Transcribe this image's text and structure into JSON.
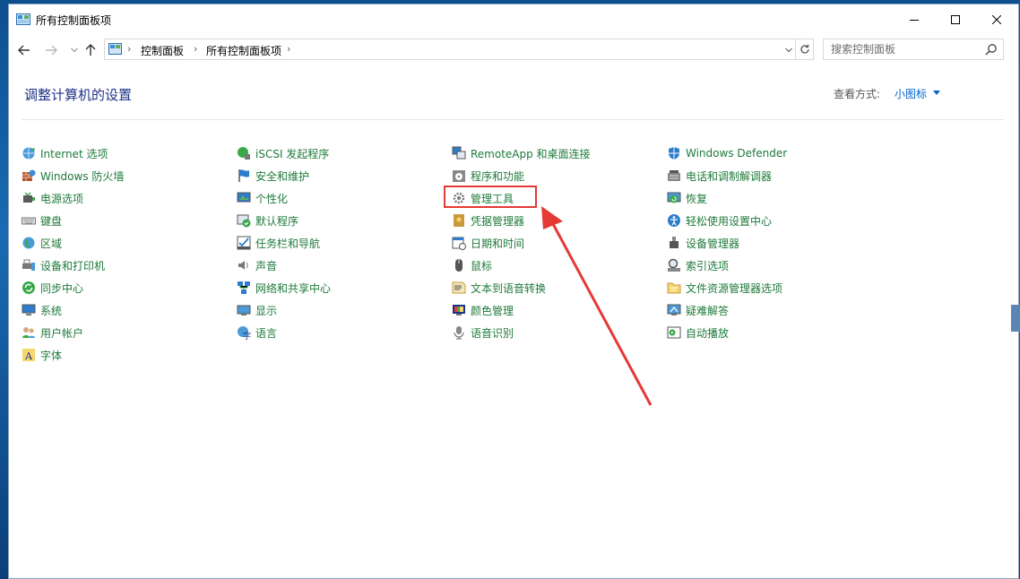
{
  "window": {
    "title": "所有控制面板项"
  },
  "address": {
    "crumbs": [
      "控制面板",
      "所有控制面板项"
    ],
    "search_placeholder": "搜索控制面板"
  },
  "main": {
    "heading": "调整计算机的设置",
    "view_by_label": "查看方式:",
    "view_by_value": "小图标"
  },
  "columns": [
    [
      {
        "label": "Internet 选项",
        "icon": "internet-options-icon"
      },
      {
        "label": "Windows 防火墙",
        "icon": "firewall-icon"
      },
      {
        "label": "电源选项",
        "icon": "power-options-icon"
      },
      {
        "label": "键盘",
        "icon": "keyboard-icon"
      },
      {
        "label": "区域",
        "icon": "region-icon"
      },
      {
        "label": "设备和打印机",
        "icon": "devices-printers-icon"
      },
      {
        "label": "同步中心",
        "icon": "sync-center-icon"
      },
      {
        "label": "系统",
        "icon": "system-icon"
      },
      {
        "label": "用户帐户",
        "icon": "user-accounts-icon"
      },
      {
        "label": "字体",
        "icon": "fonts-icon"
      }
    ],
    [
      {
        "label": "iSCSI 发起程序",
        "icon": "iscsi-icon"
      },
      {
        "label": "安全和维护",
        "icon": "security-flag-icon"
      },
      {
        "label": "个性化",
        "icon": "personalization-icon"
      },
      {
        "label": "默认程序",
        "icon": "default-programs-icon"
      },
      {
        "label": "任务栏和导航",
        "icon": "taskbar-icon"
      },
      {
        "label": "声音",
        "icon": "sound-icon"
      },
      {
        "label": "网络和共享中心",
        "icon": "network-icon"
      },
      {
        "label": "显示",
        "icon": "display-icon"
      },
      {
        "label": "语言",
        "icon": "language-icon"
      }
    ],
    [
      {
        "label": "RemoteApp 和桌面连接",
        "icon": "remoteapp-icon"
      },
      {
        "label": "程序和功能",
        "icon": "programs-features-icon"
      },
      {
        "label": "管理工具",
        "icon": "admin-tools-icon"
      },
      {
        "label": "凭据管理器",
        "icon": "credential-manager-icon"
      },
      {
        "label": "日期和时间",
        "icon": "date-time-icon"
      },
      {
        "label": "鼠标",
        "icon": "mouse-icon"
      },
      {
        "label": "文本到语音转换",
        "icon": "text-to-speech-icon"
      },
      {
        "label": "颜色管理",
        "icon": "color-management-icon"
      },
      {
        "label": "语音识别",
        "icon": "speech-recognition-icon"
      }
    ],
    [
      {
        "label": "Windows Defender",
        "icon": "defender-icon"
      },
      {
        "label": "电话和调制解调器",
        "icon": "phone-modem-icon"
      },
      {
        "label": "恢复",
        "icon": "recovery-icon"
      },
      {
        "label": "轻松使用设置中心",
        "icon": "ease-of-access-icon"
      },
      {
        "label": "设备管理器",
        "icon": "device-manager-icon"
      },
      {
        "label": "索引选项",
        "icon": "indexing-icon"
      },
      {
        "label": "文件资源管理器选项",
        "icon": "folder-options-icon"
      },
      {
        "label": "疑难解答",
        "icon": "troubleshooting-icon"
      },
      {
        "label": "自动播放",
        "icon": "autoplay-icon"
      }
    ]
  ],
  "colors": {
    "link": "#1e7a3a",
    "heading": "#1e3287",
    "accent": "#0066cc",
    "highlight": "#e53935"
  }
}
